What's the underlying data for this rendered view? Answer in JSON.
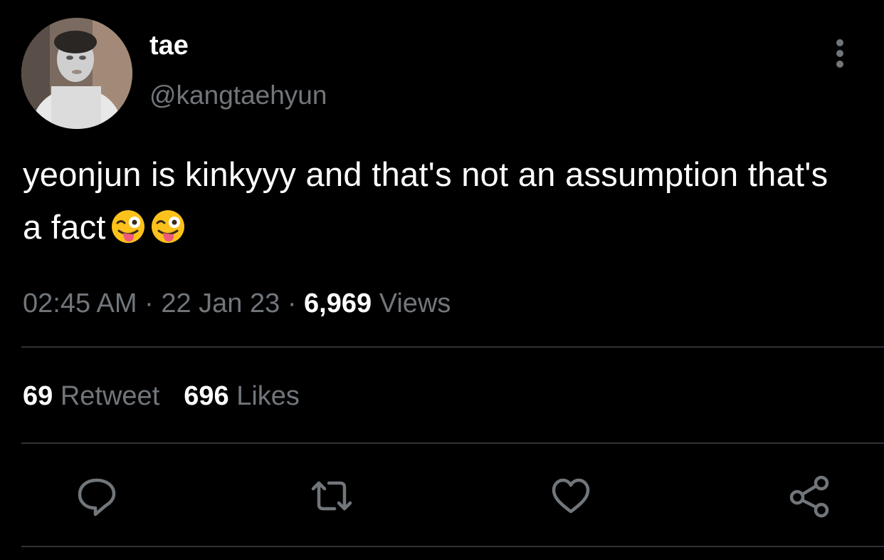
{
  "author": {
    "display_name": "tae",
    "handle": "@kangtaehyun"
  },
  "tweet": {
    "text": "yeonjun is kinkyyy and that's not an assumption that's a fact",
    "emojis": [
      "winking-face-with-tongue-emoji",
      "winking-face-with-tongue-emoji"
    ]
  },
  "meta": {
    "time": "02:45 AM",
    "sep1": " · ",
    "date": "22 Jan 23",
    "sep2": " · ",
    "views_count": "6,969",
    "views_label": "Views"
  },
  "stats": {
    "retweets_count": "69",
    "retweets_label": "Retweet",
    "likes_count": "696",
    "likes_label": "Likes"
  },
  "actions": [
    "reply-icon",
    "retweet-icon",
    "like-icon",
    "share-icon"
  ],
  "colors": {
    "background": "#000000",
    "primary_text": "#ffffff",
    "secondary_text": "#71767b",
    "divider": "#2f3336"
  }
}
